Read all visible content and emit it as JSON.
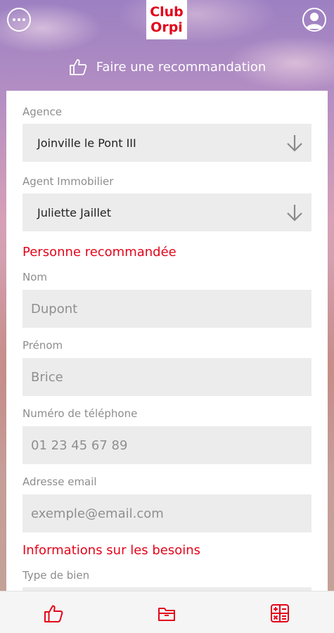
{
  "header": {
    "logo_line1": "Club",
    "logo_line2": "Orpi",
    "more_icon": "more-dots-icon",
    "profile_icon": "user-profile-icon"
  },
  "recommendation": {
    "title": "Faire une recommandation",
    "icon": "thumbs-up-icon"
  },
  "form": {
    "agency_label": "Agence",
    "agency_value": "Joinville le Pont III",
    "agent_label": "Agent Immobilier",
    "agent_value": "Juliette Jaillet",
    "person_section": "Personne recommandée",
    "nom_label": "Nom",
    "nom_placeholder": "Dupont",
    "prenom_label": "Prénom",
    "prenom_placeholder": "Brice",
    "phone_label": "Numéro de téléphone",
    "phone_placeholder": "01 23 45 67 89",
    "email_label": "Adresse email",
    "email_placeholder": "exemple@email.com",
    "needs_section": "Informations sur les besoins",
    "type_label": "Type de bien"
  },
  "tabbar": {
    "tab1_icon": "thumbs-up-icon",
    "tab2_icon": "folder-icon",
    "tab3_icon": "calculator-icon"
  },
  "colors": {
    "accent": "#e3051b",
    "field_bg": "#ececec",
    "label": "#8d8d8d"
  }
}
